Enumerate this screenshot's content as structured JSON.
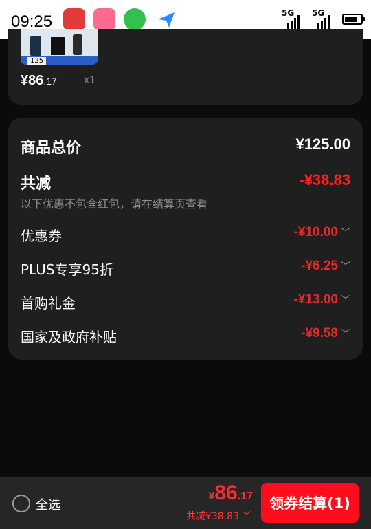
{
  "status_bar": {
    "time": "09:25",
    "network_1": "5G",
    "network_2": "5G"
  },
  "product": {
    "price_int": "¥86",
    "price_dec": ".17",
    "quantity": "x1",
    "thumb_badge": "125"
  },
  "summary": {
    "total_label": "商品总价",
    "total_value": "¥125.00",
    "reduce_label": "共减",
    "reduce_value": "-¥38.83",
    "note": "以下优惠不包含红包，请在结算页查看",
    "discounts": [
      {
        "label": "优惠券",
        "value": "-¥10.00"
      },
      {
        "label": "PLUS专享95折",
        "value": "-¥6.25"
      },
      {
        "label": "首购礼金",
        "value": "-¥13.00"
      },
      {
        "label": "国家及政府补贴",
        "value": "-¥9.58"
      }
    ],
    "chevron": "﹀"
  },
  "footer": {
    "select_all": "全选",
    "currency": "¥",
    "price_int": "86",
    "price_dec": ".17",
    "saving_text": "共减¥38.83",
    "checkout_label": "领券结算(1)"
  },
  "colors": {
    "accent_red": "#ff0d1d",
    "card_bg": "#1f1f1f",
    "page_bg": "#0b0b0b"
  }
}
